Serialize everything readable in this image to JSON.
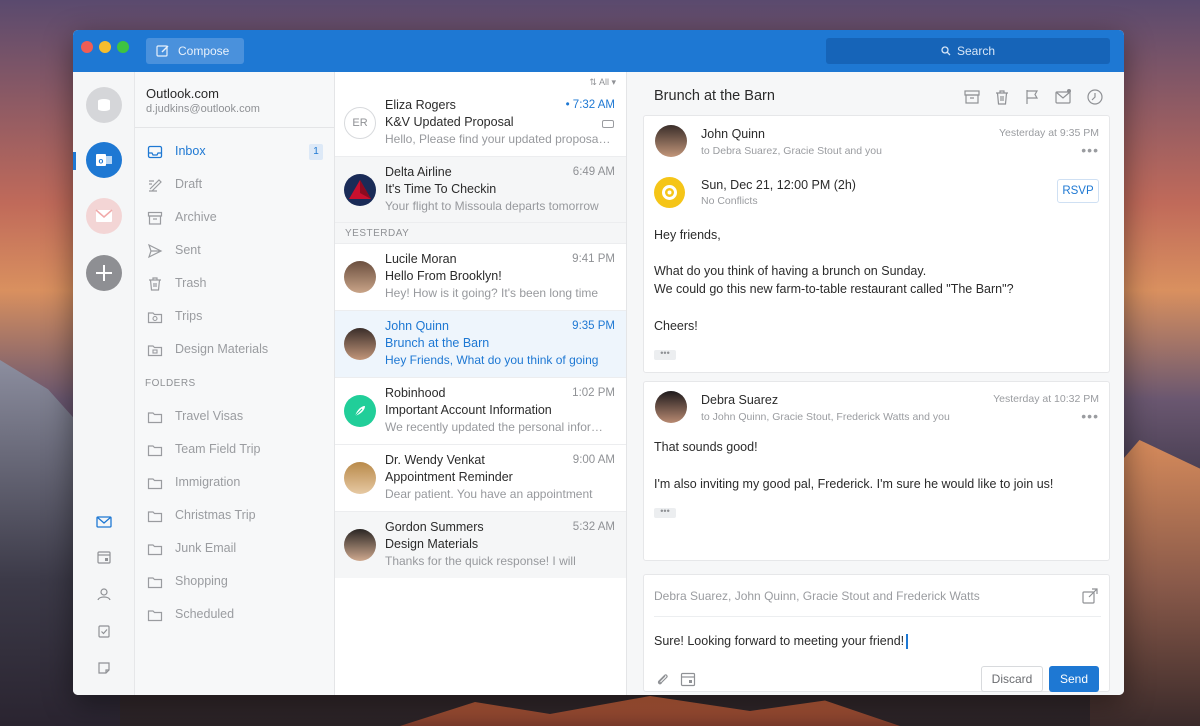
{
  "titlebar": {
    "compose_label": "Compose",
    "search_label": "Search"
  },
  "account": {
    "name": "Outlook.com",
    "email": "d.judkins@outlook.com"
  },
  "folders": {
    "items": [
      {
        "label": "Inbox",
        "badge": "1",
        "icon": "inbox-icon"
      },
      {
        "label": "Draft",
        "icon": "draft-icon"
      },
      {
        "label": "Archive",
        "icon": "archive-icon"
      },
      {
        "label": "Sent",
        "icon": "sent-icon"
      },
      {
        "label": "Trash",
        "icon": "trash-icon"
      },
      {
        "label": "Trips",
        "icon": "trips-icon"
      },
      {
        "label": "Design Materials",
        "icon": "folder-icon"
      }
    ],
    "section_title": "FOLDERS",
    "custom": [
      "Travel Visas",
      "Team Field Trip",
      "Immigration",
      "Christmas Trip",
      "Junk Email",
      "Shopping",
      "Scheduled"
    ]
  },
  "list": {
    "filter_label": "All",
    "section_yesterday": "YESTERDAY",
    "messages": [
      {
        "sender": "Eliza Rogers",
        "initials": "ER",
        "subject": "K&V Updated Proposal",
        "preview": "Hello, Please find your updated proposal attached",
        "time": "• 7:32 AM"
      },
      {
        "sender": "Delta Airline",
        "subject": "It's Time To Checkin",
        "preview": "Your flight to Missoula departs tomorrow",
        "time": "6:49 AM"
      },
      {
        "sender": "Lucile Moran",
        "subject": "Hello From Brooklyn!",
        "preview": "Hey! How is it going?  It's been long time",
        "time": "9:41 PM"
      },
      {
        "sender": "John Quinn",
        "subject": "Brunch at the Barn",
        "preview": "Hey Friends, What do you think of going",
        "time": "9:35 PM"
      },
      {
        "sender": "Robinhood",
        "subject": "Important Account Information",
        "preview": "We recently updated the personal information",
        "time": "1:02 PM"
      },
      {
        "sender": "Dr. Wendy Venkat",
        "subject": "Appointment Reminder",
        "preview": "Dear patient. You have an appointment",
        "time": "9:00 AM"
      },
      {
        "sender": "Gordon Summers",
        "subject": "Design Materials",
        "preview": "Thanks for the quick response! I will",
        "time": "5:32 AM"
      }
    ]
  },
  "reader": {
    "title": "Brunch at the Barn",
    "first": {
      "name": "John Quinn",
      "recipients": "to Debra Suarez, Gracie Stout and you",
      "time": "Yesterday at 9:35 PM",
      "more": "•••",
      "event_title": "Sun, Dec 21, 12:00 PM (2h)",
      "event_sub": "No Conflicts",
      "rsvp_label": "RSVP",
      "line1": "Hey friends,",
      "line2": "What do you think of having a brunch on Sunday.",
      "line3": "We could go this new farm-to-table restaurant called \"The Barn\"?",
      "line4": "Cheers!",
      "ellipsis": "•••"
    },
    "second": {
      "name": "Debra Suarez",
      "recipients": "to John Quinn, Gracie Stout, Frederick Watts and you",
      "time": "Yesterday at 10:32 PM",
      "more": "•••",
      "line1": "That sounds good!",
      "line2": "I'm also inviting my good pal, Frederick. I'm sure he would like to join us!",
      "ellipsis": "•••"
    },
    "reply": {
      "to": "Debra Suarez, John Quinn, Gracie Stout and Frederick Watts",
      "text": "Sure! Looking forward to meeting your friend!",
      "discard_label": "Discard",
      "send_label": "Send"
    }
  },
  "colors": {
    "accent": "#1e78d3",
    "titlebar": "#1e78d3"
  }
}
